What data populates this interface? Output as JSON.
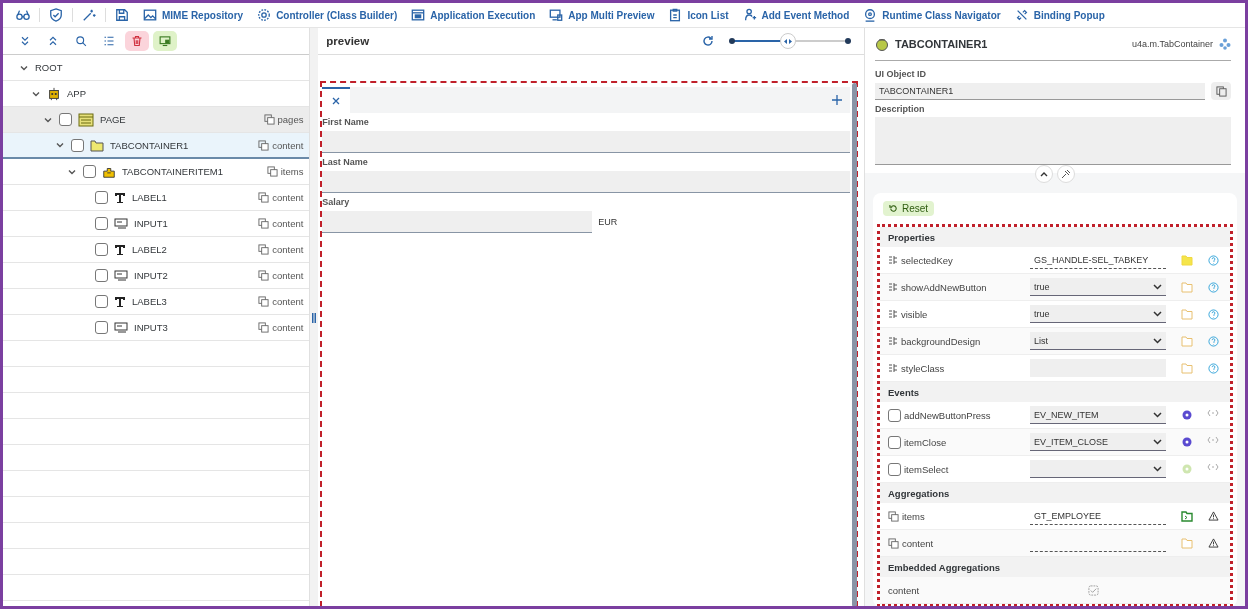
{
  "toolbar": [
    {
      "kind": "glasses"
    },
    {
      "kind": "shield"
    },
    {
      "kind": "magic"
    },
    {
      "kind": "save"
    },
    {
      "kind": "image",
      "label": "MIME Repository"
    },
    {
      "kind": "gear",
      "label": "Controller (Class Builder)"
    },
    {
      "kind": "window",
      "label": "Application Execution"
    },
    {
      "kind": "devices",
      "label": "App Multi Preview"
    },
    {
      "kind": "clipboard",
      "label": "Icon List"
    },
    {
      "kind": "person",
      "label": "Add Event Method"
    },
    {
      "kind": "pin",
      "label": "Runtime Class Navigator"
    },
    {
      "kind": "link",
      "label": "Binding Popup"
    }
  ],
  "tree_toolbar": [
    {
      "kind": "expand-all"
    },
    {
      "kind": "collapse-all"
    },
    {
      "kind": "search"
    },
    {
      "kind": "list"
    },
    {
      "kind": "delete"
    },
    {
      "kind": "screen"
    }
  ],
  "tree": [
    {
      "label": "ROOT",
      "expanded": true,
      "selected": false,
      "hovered": false,
      "children": [
        {
          "label": "APP",
          "kind": "app",
          "expanded": true,
          "selected": false,
          "hovered": false,
          "children": [
            {
              "label": "PAGE",
              "kind": "page",
              "checked": false,
              "aggregation": "pages",
              "expanded": true,
              "selected": false,
              "hovered": true,
              "children": [
                {
                  "label": "TABCONTAINER1",
                  "kind": "folder",
                  "checked": false,
                  "aggregation": "content",
                  "expanded": true,
                  "selected": true,
                  "hovered": false,
                  "children": [
                    {
                      "label": "TABCONTAINERITEM1",
                      "kind": "tabitem",
                      "checked": false,
                      "aggregation": "items",
                      "expanded": true,
                      "selected": false,
                      "hovered": false,
                      "children": [
                        {
                          "label": "LABEL1",
                          "kind": "label",
                          "checked": false,
                          "aggregation": "content",
                          "selected": false,
                          "hovered": false
                        },
                        {
                          "label": "INPUT1",
                          "kind": "input",
                          "checked": false,
                          "aggregation": "content",
                          "selected": false,
                          "hovered": false
                        },
                        {
                          "label": "LABEL2",
                          "kind": "label",
                          "checked": false,
                          "aggregation": "content",
                          "selected": false,
                          "hovered": false
                        },
                        {
                          "label": "INPUT2",
                          "kind": "input",
                          "checked": false,
                          "aggregation": "content",
                          "selected": false,
                          "hovered": false
                        },
                        {
                          "label": "LABEL3",
                          "kind": "label",
                          "checked": false,
                          "aggregation": "content",
                          "selected": false,
                          "hovered": false
                        },
                        {
                          "label": "INPUT3",
                          "kind": "input",
                          "checked": false,
                          "aggregation": "content",
                          "selected": false,
                          "hovered": false
                        }
                      ]
                    }
                  ]
                }
              ]
            }
          ]
        }
      ]
    }
  ],
  "preview": {
    "title": "preview",
    "zoom": {
      "level": 0.48
    },
    "form": {
      "fields": [
        {
          "label": "First Name",
          "wide": true
        },
        {
          "label": "Last Name",
          "wide": true
        },
        {
          "label": "Salary",
          "wide": false,
          "unit": "EUR"
        }
      ]
    }
  },
  "inspector": {
    "title": "TABCONTAINER1",
    "type": "u4a.m.TabContainer",
    "object_id": {
      "label": "UI Object ID",
      "value": "TABCONTAINER1"
    },
    "description": {
      "label": "Description"
    },
    "reset": "Reset",
    "sections": [
      {
        "title": "Properties",
        "rows": [
          {
            "kind": "property",
            "name": "selectedKey",
            "field": {
              "kind": "binding",
              "value": "GS_HANDLE-SEL_TABKEY"
            },
            "bound": true
          },
          {
            "kind": "property",
            "name": "showAddNewButton",
            "field": {
              "kind": "select",
              "value": "true"
            },
            "bound": false
          },
          {
            "kind": "property",
            "name": "visible",
            "field": {
              "kind": "select",
              "value": "true"
            },
            "bound": false
          },
          {
            "kind": "property",
            "name": "backgroundDesign",
            "field": {
              "kind": "select",
              "value": "List"
            },
            "bound": false
          },
          {
            "kind": "property",
            "name": "styleClass",
            "field": {
              "kind": "text"
            },
            "bound": false
          }
        ]
      },
      {
        "title": "Events",
        "rows": [
          {
            "kind": "event",
            "name": "addNewButtonPress",
            "checked": false,
            "field": {
              "kind": "select",
              "value": "EV_NEW_ITEM"
            },
            "bound": true
          },
          {
            "kind": "event",
            "name": "itemClose",
            "checked": false,
            "field": {
              "kind": "select",
              "value": "EV_ITEM_CLOSE"
            },
            "bound": true
          },
          {
            "kind": "event",
            "name": "itemSelect",
            "checked": false,
            "field": {
              "kind": "select"
            },
            "bound": false
          }
        ]
      },
      {
        "title": "Aggregations",
        "rows": [
          {
            "kind": "aggregation",
            "name": "items",
            "field": {
              "kind": "binding",
              "value": "GT_EMPLOYEE"
            },
            "bound": true
          },
          {
            "kind": "aggregation",
            "name": "content",
            "field": {
              "kind": "binding"
            },
            "bound": false
          }
        ]
      },
      {
        "title": "Embedded Aggregations",
        "rows": [
          {
            "kind": "embedded",
            "name": "content"
          }
        ]
      }
    ]
  }
}
